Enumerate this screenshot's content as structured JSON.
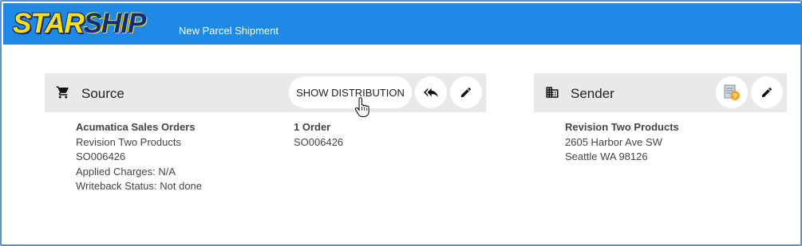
{
  "header": {
    "logo_part1": "STAR",
    "logo_part2": "SHIP",
    "app_title": "New Parcel Shipment"
  },
  "source": {
    "title": "Source",
    "icon": "cart-icon",
    "show_distribution_label": "SHOW DISTRIBUTION",
    "reply_icon": "reply-all-icon",
    "edit_icon": "pencil-icon",
    "details": {
      "heading": "Acumatica Sales Orders",
      "company": "Revision Two Products",
      "order_number": "SO006426",
      "applied_charges": "Applied Charges: N/A",
      "writeback_status": "Writeback Status: Not done"
    },
    "orders": {
      "heading": "1 Order",
      "order_number": "SO006426"
    }
  },
  "sender": {
    "title": "Sender",
    "icon": "building-icon",
    "help_icon": "address-help-icon",
    "edit_icon": "pencil-icon",
    "details": {
      "name": "Revision Two Products",
      "street": "2605 Harbor Ave SW",
      "city": "Seattle WA 98126"
    }
  },
  "colors": {
    "topbar": "#1f8ae6",
    "logo_yellow": "#ffe100",
    "logo_navy": "#0d2c8a",
    "panel_header": "#e9e9e9"
  }
}
